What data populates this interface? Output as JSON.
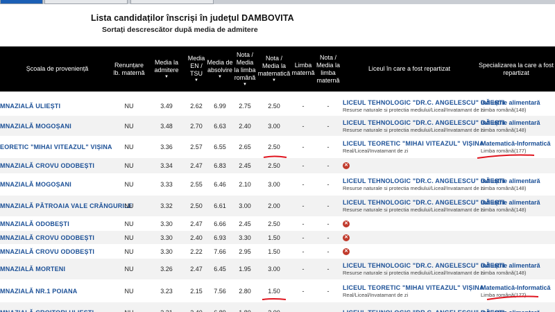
{
  "page": {
    "title": "Lista candidaților înscriși în județul DAMBOVITA",
    "subtitle": "Sortați descrescător după media de admitere"
  },
  "columns": {
    "scoala": "Școala de proveniență",
    "renuntare": "Renunțare lb. maternă",
    "media_admitere": "Media la admitere",
    "media_en": "Media EN / TSU",
    "media_abs": "Media de absolvire",
    "nota_ro": "Nota / Media la limba română",
    "nota_mate": "Nota / Media la matematică",
    "limba_materna": "Limba maternă",
    "nota_lm": "Nota / Media la limba maternă",
    "liceu": "Liceul în care a fost repartizat",
    "specializare": "Specializarea la care a fost repartizat"
  },
  "rows": [
    {
      "scoala": "MNAZIALĂ ULIEȘTI",
      "renuntare": "NU",
      "ma": "3.49",
      "en": "2.62",
      "abs": "6.99",
      "ro": "2.75",
      "mate": "2.50",
      "lm": "-",
      "nlm": "-",
      "liceu": "LICEUL TEHNOLOGIC \"DR.C. ANGELESCU\" GĂEȘTI",
      "liceu_sub": "Resurse naturale si protectia mediului/Liceal/Invatamant de zi",
      "spec": "Industrie alimentară",
      "spec_sub": "Limba română(148)",
      "respins": false
    },
    {
      "scoala": "MNAZIALĂ MOGOȘANI",
      "renuntare": "NU",
      "ma": "3.48",
      "en": "2.70",
      "abs": "6.63",
      "ro": "2.40",
      "mate": "3.00",
      "lm": "-",
      "nlm": "-",
      "liceu": "LICEUL TEHNOLOGIC \"DR.C. ANGELESCU\" GĂEȘTI",
      "liceu_sub": "Resurse naturale si protectia mediului/Liceal/Invatamant de zi",
      "spec": "Industrie alimentară",
      "spec_sub": "Limba română(148)",
      "respins": false
    },
    {
      "scoala": "EORETIC \"MIHAI VITEAZUL\" VIȘINA",
      "renuntare": "NU",
      "ma": "3.36",
      "en": "2.57",
      "abs": "6.55",
      "ro": "2.65",
      "mate": "2.50",
      "lm": "-",
      "nlm": "-",
      "liceu": "LICEUL TEORETIC \"MIHAI VITEAZUL\" VIȘINA",
      "liceu_sub": "Real/Liceal/Invatamant de zi",
      "spec": "Matematică-Informatică",
      "spec_sub": "Limba română(177)",
      "respins": false
    },
    {
      "scoala": "MNAZIALĂ CROVU ODOBEȘTI",
      "renuntare": "NU",
      "ma": "3.34",
      "en": "2.47",
      "abs": "6.83",
      "ro": "2.45",
      "mate": "2.50",
      "lm": "-",
      "nlm": "-",
      "liceu": "",
      "liceu_sub": "",
      "spec": "",
      "spec_sub": "",
      "respins": true
    },
    {
      "scoala": "MNAZIALĂ MOGOȘANI",
      "renuntare": "NU",
      "ma": "3.33",
      "en": "2.55",
      "abs": "6.46",
      "ro": "2.10",
      "mate": "3.00",
      "lm": "-",
      "nlm": "-",
      "liceu": "LICEUL TEHNOLOGIC \"DR.C. ANGELESCU\" GĂEȘTI",
      "liceu_sub": "Resurse naturale si protectia mediului/Liceal/Invatamant de zi",
      "spec": "Industrie alimentară",
      "spec_sub": "Limba română(148)",
      "respins": false
    },
    {
      "scoala": "MNAZIALĂ PĂTROAIA VALE CRĂNGURILE",
      "renuntare": "NU",
      "ma": "3.32",
      "en": "2.50",
      "abs": "6.61",
      "ro": "3.00",
      "mate": "2.00",
      "lm": "-",
      "nlm": "-",
      "liceu": "LICEUL TEHNOLOGIC \"DR.C. ANGELESCU\" GĂEȘTI",
      "liceu_sub": "Resurse naturale si protectia mediului/Liceal/Invatamant de zi",
      "spec": "Industrie alimentară",
      "spec_sub": "Limba română(148)",
      "respins": false
    },
    {
      "scoala": "MNAZIALĂ ODOBEȘTI",
      "renuntare": "NU",
      "ma": "3.30",
      "en": "2.47",
      "abs": "6.66",
      "ro": "2.45",
      "mate": "2.50",
      "lm": "-",
      "nlm": "-",
      "liceu": "",
      "liceu_sub": "",
      "spec": "",
      "spec_sub": "",
      "respins": true
    },
    {
      "scoala": "MNAZIALĂ CROVU ODOBEȘTI",
      "renuntare": "NU",
      "ma": "3.30",
      "en": "2.40",
      "abs": "6.93",
      "ro": "3.30",
      "mate": "1.50",
      "lm": "-",
      "nlm": "-",
      "liceu": "",
      "liceu_sub": "",
      "spec": "",
      "spec_sub": "",
      "respins": true
    },
    {
      "scoala": "MNAZIALĂ CROVU ODOBEȘTI",
      "renuntare": "NU",
      "ma": "3.30",
      "en": "2.22",
      "abs": "7.66",
      "ro": "2.95",
      "mate": "1.50",
      "lm": "-",
      "nlm": "-",
      "liceu": "",
      "liceu_sub": "",
      "spec": "",
      "spec_sub": "",
      "respins": true
    },
    {
      "scoala": "MNAZIALĂ MORTENI",
      "renuntare": "NU",
      "ma": "3.26",
      "en": "2.47",
      "abs": "6.45",
      "ro": "1.95",
      "mate": "3.00",
      "lm": "-",
      "nlm": "-",
      "liceu": "LICEUL TEHNOLOGIC \"DR.C. ANGELESCU\" GĂEȘTI",
      "liceu_sub": "Resurse naturale si protectia mediului/Liceal/Invatamant de zi",
      "spec": "Industrie alimentară",
      "spec_sub": "Limba română(148)",
      "respins": false
    },
    {
      "scoala": "MNAZIALĂ NR.1 POIANA",
      "renuntare": "NU",
      "ma": "3.23",
      "en": "2.15",
      "abs": "7.56",
      "ro": "2.80",
      "mate": "1.50",
      "lm": "-",
      "nlm": "-",
      "liceu": "LICEUL TEORETIC \"MIHAI VITEAZUL\" VIȘINA",
      "liceu_sub": "Real/Liceal/Invatamant de zi",
      "spec": "Matematică-Informatică",
      "spec_sub": "Limba română(177)",
      "respins": false
    },
    {
      "scoala": "MNAZIALĂ CROITORI ULIEȘTI",
      "renuntare": "NU",
      "ma": "3.21",
      "en": "2.40",
      "abs": "6.89",
      "ro": "1.80",
      "mate": "3.00",
      "lm": "-",
      "nlm": "-",
      "liceu": "LICEUL TEHNOLOGIC \"DR.C. ANGELESCU\" GĂEȘTI",
      "liceu_sub": "",
      "spec": "Industrie alimentară",
      "spec_sub": "",
      "respins": false
    }
  ],
  "colors": {
    "header_bg": "#000000",
    "link": "#1a4f96",
    "annotation": "#e0141e",
    "reject_icon": "#c0392b"
  },
  "icons": {
    "reject": "x-circle-icon",
    "sort": "sort-desc-icon"
  }
}
